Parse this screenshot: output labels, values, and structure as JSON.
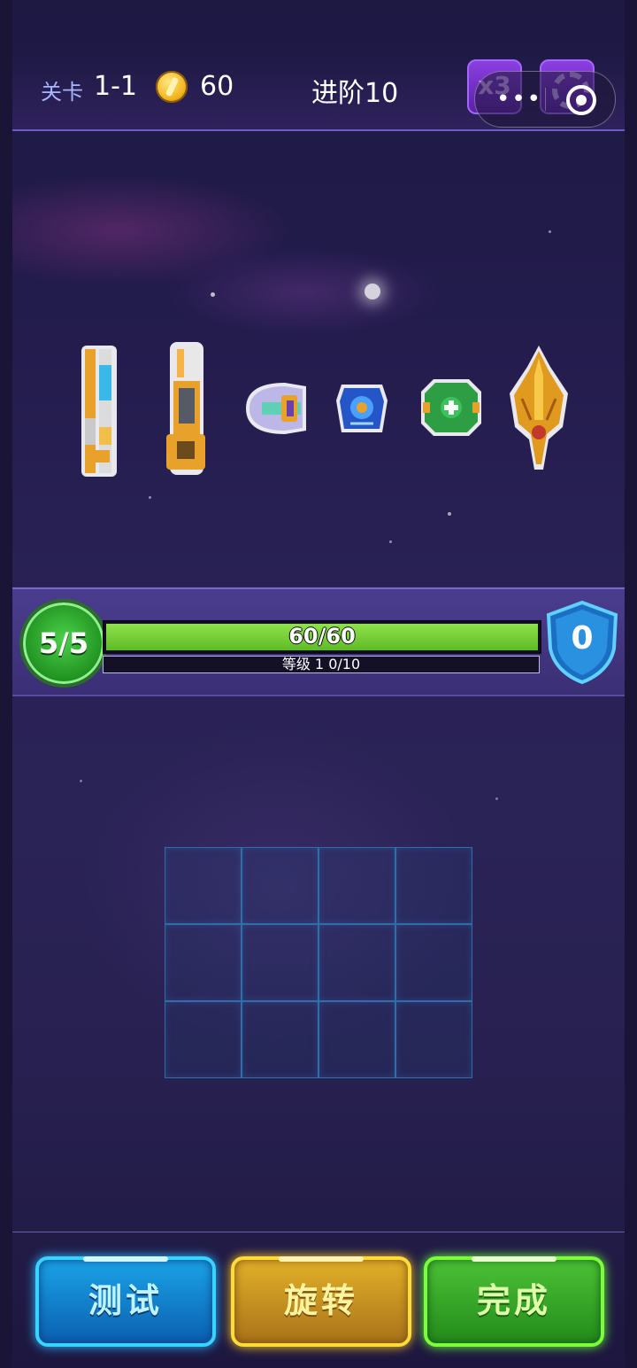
{
  "header": {
    "stage_label": "关卡",
    "stage_value": "1-1",
    "coins": "60",
    "advance": "进阶10",
    "speed_label": "x3"
  },
  "capsule": {
    "more_label": "•••"
  },
  "parts": [
    {
      "name": "twin-laser-cannon",
      "color": "#f0a020"
    },
    {
      "name": "heavy-cannon",
      "color": "#f0a020"
    },
    {
      "name": "plasma-pod",
      "color": "#c8c8ff"
    },
    {
      "name": "blue-core-module",
      "color": "#2a6cf0"
    },
    {
      "name": "green-repair-module",
      "color": "#2ea84a"
    },
    {
      "name": "gold-fighter-ship",
      "color": "#e09a20"
    }
  ],
  "status": {
    "wave": "5/5",
    "hp_text": "60/60",
    "hp_fraction": 1.0,
    "level_text": "等级 1  0/10",
    "xp_fraction": 0.0,
    "shield_value": "0"
  },
  "grid": {
    "rows": 3,
    "cols": 4
  },
  "actions": {
    "test_label": "测试",
    "rotate_label": "旋转",
    "done_label": "完成"
  }
}
